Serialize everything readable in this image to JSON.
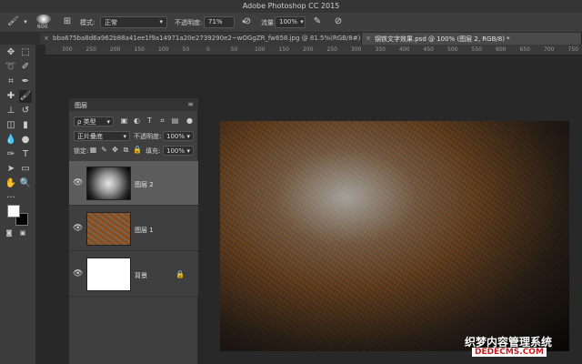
{
  "app": {
    "title": "Adobe Photoshop CC 2015"
  },
  "options": {
    "brush_size": "600",
    "mode_label": "模式:",
    "mode_value": "正常",
    "opacity_label": "不透明度:",
    "opacity_value": "71%",
    "flow_label": "流量:",
    "flow_value": "100%"
  },
  "tabs": [
    {
      "label": "bba675ba8d6a962b88a41ee1f9a14971a20e2739290e2~wOGgZR_fw658.jpg @ 81.5%(RGB/8#)"
    },
    {
      "label": "钢铁文字效果.psd @ 100% (图层 2, RGB/8) *"
    }
  ],
  "ruler": {
    "ticks": [
      "300",
      "250",
      "200",
      "150",
      "100",
      "50",
      "0",
      "50",
      "100",
      "150",
      "200",
      "250",
      "300",
      "350",
      "400",
      "450",
      "500",
      "550",
      "600",
      "650",
      "700",
      "750"
    ]
  },
  "layers_panel": {
    "title": "图层",
    "filter_label": "ρ 类型",
    "blend_mode": "正片叠底",
    "opacity_label": "不透明度:",
    "opacity_value": "100%",
    "lock_label": "锁定:",
    "fill_label": "填充:",
    "fill_value": "100%",
    "layers": [
      {
        "name": "图层 2",
        "active": true
      },
      {
        "name": "图层 1",
        "active": false
      },
      {
        "name": "背景",
        "active": false,
        "locked": true
      }
    ]
  },
  "watermark": {
    "line1": "织梦内容管理系统",
    "line2": "DEDECMS.COM"
  },
  "colors": {
    "foreground": "#ffffff",
    "background": "#000000"
  }
}
